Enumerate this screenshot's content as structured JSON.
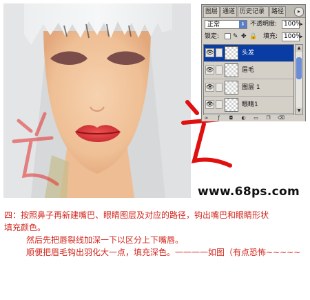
{
  "layers_panel": {
    "tabs": [
      {
        "label": "图层",
        "active": true
      },
      {
        "label": "通道",
        "active": false
      },
      {
        "label": "历史记录",
        "active": false
      },
      {
        "label": "路径",
        "active": false
      }
    ],
    "blend_mode": "正常",
    "opacity_label": "不透明度:",
    "opacity_value": "100%",
    "lock_label": "锁定:",
    "fill_label": "填充:",
    "fill_value": "100%",
    "layers": [
      {
        "name": "头发",
        "selected": true,
        "visible": true
      },
      {
        "name": "眉毛",
        "selected": false,
        "visible": true
      },
      {
        "name": "图层 1",
        "selected": false,
        "visible": true
      },
      {
        "name": "眼睛1",
        "selected": false,
        "visible": true
      }
    ]
  },
  "watermark": {
    "calligraphy_text": "光",
    "url": "www.68ps.com"
  },
  "caption": {
    "line1": "四：按照鼻子再新建嘴巴、眼睛图层及对应的路径，钩出嘴巴和眼睛形状",
    "line2": "填充颜色。",
    "line3": "然后先把唇裂线加深一下以区分上下嘴唇。",
    "line4": "顺便把眉毛钩出羽化大一点，填充深色。一一一一如图（有点恐怖~~~~~"
  },
  "colors": {
    "caption": "#d1281f",
    "skin": "#f2c7a0",
    "lips": "#d63a3c",
    "eyes": "#7a4d4a",
    "selected_layer": "#0a3da3"
  }
}
